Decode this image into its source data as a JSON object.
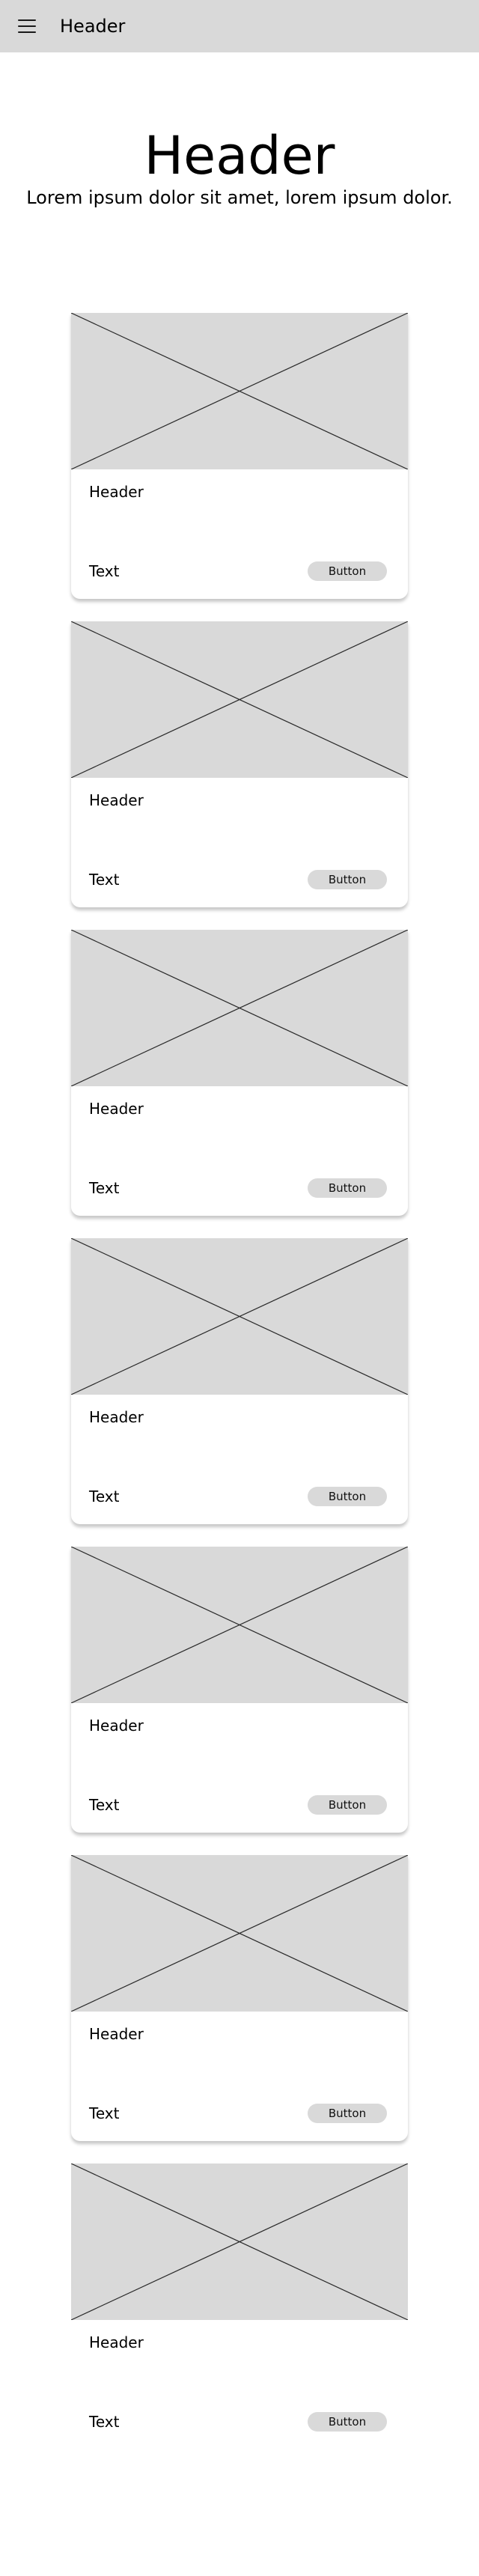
{
  "topbar": {
    "title": "Header",
    "menu_icon": "hamburger-menu-icon",
    "background": "#d9d9d9"
  },
  "hero": {
    "title": "Header",
    "subtitle": "Lorem ipsum dolor sit amet, lorem ipsum dolor."
  },
  "cards": [
    {
      "image": "image-placeholder-icon",
      "header": "Header",
      "text": "Text",
      "button_label": "Button"
    },
    {
      "image": "image-placeholder-icon",
      "header": "Header",
      "text": "Text",
      "button_label": "Button"
    },
    {
      "image": "image-placeholder-icon",
      "header": "Header",
      "text": "Text",
      "button_label": "Button"
    },
    {
      "image": "image-placeholder-icon",
      "header": "Header",
      "text": "Text",
      "button_label": "Button"
    },
    {
      "image": "image-placeholder-icon",
      "header": "Header",
      "text": "Text",
      "button_label": "Button"
    },
    {
      "image": "image-placeholder-icon",
      "header": "Header",
      "text": "Text",
      "button_label": "Button"
    },
    {
      "image": "image-placeholder-icon",
      "header": "Header",
      "text": "Text",
      "button_label": "Button"
    }
  ],
  "colors": {
    "placeholder_fill": "#d9d9d9",
    "button_fill": "#d9d9d9",
    "page_background": "#ffffff"
  }
}
